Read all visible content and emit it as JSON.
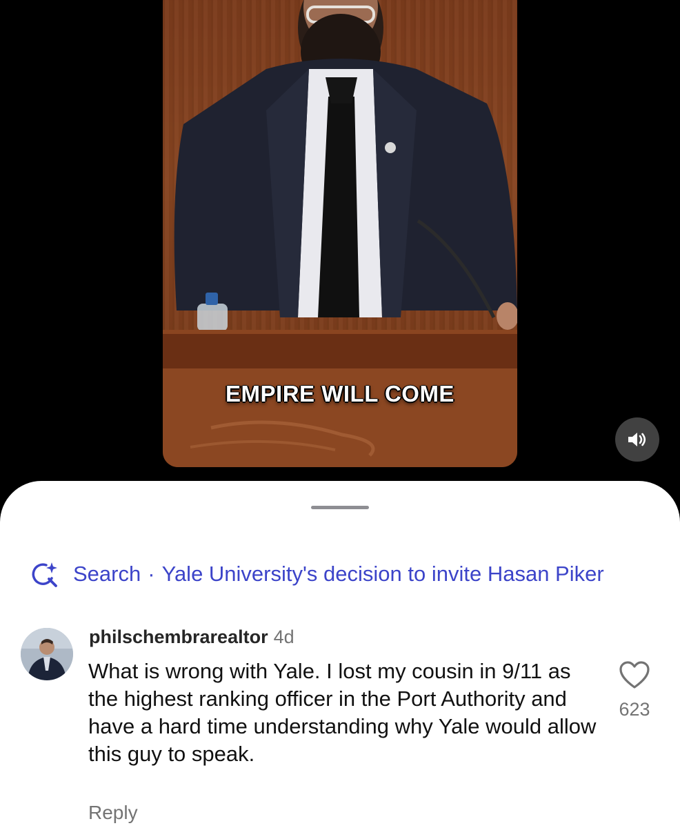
{
  "video": {
    "caption": "EMPIRE WILL COME",
    "mute_icon": "speaker-on-icon"
  },
  "search": {
    "icon": "ai-search-sparkle-icon",
    "label": "Search",
    "separator": "·",
    "query": "Yale University's decision to invite Hasan Piker"
  },
  "comment": {
    "username": "philschembrarealtor",
    "time": "4d",
    "text": "What is wrong with Yale. I lost my cousin in 9/11 as the highest ranking officer in the Port Authority and have a hard time understanding why Yale would allow this guy to speak.",
    "reply_label": "Reply",
    "like_icon": "heart-outline-icon",
    "like_count": "623"
  },
  "colors": {
    "accent": "#3c44c9",
    "secondary_text": "#737373",
    "mute_button_bg": "#464646"
  }
}
